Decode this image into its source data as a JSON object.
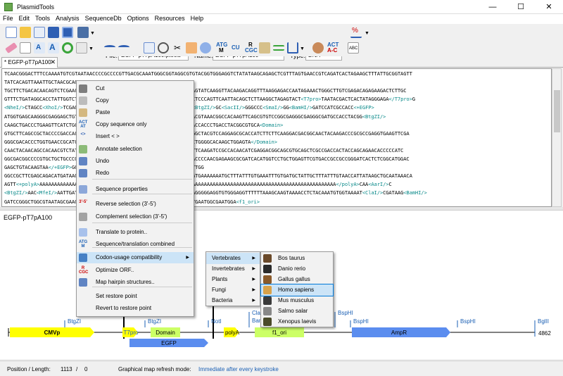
{
  "window": {
    "title": "PlasmidTools",
    "minimize": "—",
    "maximize": "☐",
    "close": "✕"
  },
  "menubar": [
    "File",
    "Edit",
    "Tools",
    "Analysis",
    "SequenceDb",
    "Options",
    "Resources",
    "Help"
  ],
  "toolbar": {
    "file_label": "File:",
    "file_value": "EGFP-pT7pA100.ptools",
    "name_label": "Name:",
    "name_value": "EGFP-pT7pA100",
    "type_label": "Type:",
    "type_value": "DNA",
    "atg_text": "ATG",
    "m_text": "M",
    "cu_text": "CU",
    "r_text": "R",
    "cgc_text": "CGC",
    "c_text": "C",
    "act_text": "ACT",
    "ac_text": "A-C",
    "abc_text": "ABC"
  },
  "tab": {
    "label": "* EGFP-pT7pA100",
    "close": "✕"
  },
  "sequence_lines": [
    [
      "TCAACGGGACTTTCCAAAATGTCGTAATAACCCCGCCCCGTTGACGCAAATGGGCGGTAGGCGTGTACGGTGGGAGGTCTATATAAGCAGAGCTCGTTTAGTGAACCGTCAGATCACTAGAAGCTTTATTGCGGTAGTT"
    ],
    [
      "TATCACAGTTAAATTGCTAACGCAGTCAGTG",
      "tag:<CMVp/>"
    ],
    [
      "TGCTTCTGACACAACAGTCTCGAACTTAAGCTGCAGAAGTTGGTCGTGAGGCACTGGGCAGGTAAGTATCAAGGTTACAAGACAGGTTTAAGGAGACCAATAGAAACTGGGCTTGTCGAGACAGAGAAGACTCTTGC"
    ],
    [
      "GTTTCTGATAGGCACCTATTGGTCTTACTGACATCCACTTTGCCTTTCTCTCCACAGGTGTCCACTCCCAGTTCAATTACAGCTCTTAAGGCTAGAGTACT",
      "tag:<T7pro>",
      "TAATACGACTCACTATAGGGAGA",
      "tag:</T7pro>",
      "G"
    ],
    [
      "tag:<NheI/>",
      "CTAGCC",
      "tag:<XhoI/>",
      "TCGAGCTCAAGCTTCGAATTCTG",
      "tag:<Acc65I/>",
      "GTAC",
      "tag:<KpnI/>",
      "C",
      "tag:<BtgZI/>",
      "GC",
      "tag:<SacII/>",
      "GGGCCC",
      "tag:<SmaI/>",
      "GG",
      "tag:<BamHI/>",
      "GATCCATCGCCACC",
      "tag:<+EGFP>"
    ],
    [
      "ATGGTGAGCAAGGGCGAGGAGCTGTTCACCGGGGTGGTGCCCATCCTGGTCGAGCTGGACGGCGACGTAAACGGCCACAAGTTCAGCGTGTCCGGCGAGGGCGAGGGCGATGCCACCTACGG",
      "tag:<BtgZI/>"
    ],
    [
      "CAAGCTGACCCTGAAGTTCATCTGCACCACCGGCAAGCTGCCCGTGCCCTGGCCCACCCTCGTGACCACCCTGACCTACGGCGTGCA",
      "tag:<Domain>"
    ],
    [
      "GTGCTTCAGCCGCTACCCCGACCACATGAAGCAGCACGACTTCTTCAAGTCCGCCATGCCCGAAGGCTACGTCCAGGAGCGCACCATCTTCTTCAAGGACGACGGCAACTACAAGACCCGCGCCGAGGTGAAGTTCGA"
    ],
    [
      "GGGCGACACCCTGGTGAACCGCATCGAGCTGAAGGGCATCGACTTCAAGGAGGACGGCAACATCCTGGGGCACAAGCTGGAGTA",
      "tag:</Domain>"
    ],
    [
      "CAACTACAACAGCCACAACGTCTATATCATGGCCGACAAGCAGAAGAACGGCATCAAGGTGAACTTCAAGATCCGCCACAACATCGAGGACGGCAGCGTGCAGCTCGCCGACCACTACCAGCAGAACACCCCCATC"
    ],
    [
      "GGCGACGGCCCCGTGCTGCTGCCCGACAACCACTACCTGAGCACCCAGTCCGCCCTGAGCAAAGACCCCAACGAGAAGCGCGATCACATGGTCCTGCTGGAGTTCGTGACCGCCGCCGGGATCACTCTCGGCATGGAC"
    ],
    [
      "GAGCTGTACAAGTAA",
      "tag:</+EGFP>",
      "GCGGCCGCTTCGAGCAGACATGATAAGATACATTGATGAGTTTGG"
    ],
    [
      "GGCCGCTTCGAGCAGACATGATAAGATACATTGATGAGTTTGGACAAACCACAACTAGAATGCAGTGAAAAAAATGCTTTATTTGTGAAATTTGTGATGCTATTGCTTTATTTGTAACCATTATAAGCTGCAATAAACA"
    ],
    [
      "AGTT",
      "tag:<+polyA>",
      "AAAAAAAAAAAAAAAAAAAAAAAAAAAAAAAAAAAAAAAAAAAAAAAAAAAAAAAAAAAAAAAAAAAAAAAAAAAAAAAAAAAAAAAAAAAAAAAAAAAAA",
      "tag:</polyA>",
      "CAA",
      "tag:<AarI/>",
      "C"
    ],
    [
      "tag:<BtgZI/>",
      "AAC",
      "tag:<MfeI/>",
      "AATTGATCCTCGAGAAGTGGTTTTTTGCCCACCTTGTTTCAGGTTCAGGGGGAGGTGTGGGAGGTTTTTTAAAGCAAGTAAAACCTCTACAAATGTGGTAAAAT",
      "tag:<ClaI/>",
      "CGATAAG",
      "tag:<BamHI/>"
    ],
    [
      "GATCCGGGCTGGCGTAATAGCGAAGAGGCCCGCACCGATCGCCCTTCCCAACAGTTGCGCAGCCTGAATGGCGAATGGA",
      "tag:<f1_ori>"
    ]
  ],
  "map": {
    "title": "EGFP-pT7pA100",
    "features": [
      "CMVp",
      "T7pro",
      "Domain",
      "EGFP",
      "polyA",
      "f1_ori",
      "AmpR"
    ],
    "sites": [
      "BtgZI",
      "BtgZI",
      "NotI",
      "Nhel",
      "ClaI",
      "Bam",
      "BspHI",
      "BspHI",
      "BspHI",
      "BglII"
    ],
    "length_label": "4862"
  },
  "status": {
    "position_label": "Position / Length:",
    "position_value": "1113",
    "slash": "/",
    "length_value": "0",
    "refresh_label": "Graphical map refresh mode:",
    "refresh_value": "Immediate after every keystroke"
  },
  "context_menu": {
    "items": [
      {
        "label": "Cut",
        "icon": "scissors-icon"
      },
      {
        "label": "Copy",
        "icon": "copy-icon"
      },
      {
        "label": "Paste",
        "icon": "paste-icon"
      },
      {
        "label": "Copy sequence only",
        "icon": "copy-sequence-icon",
        "icon_text": "ACT AT"
      },
      {
        "label": "Insert < >",
        "icon": "insert-tag-icon",
        "icon_text": "<>"
      },
      {
        "label": "Annotate selection",
        "icon": "annotate-icon"
      },
      {
        "label": "Undo",
        "icon": "undo-icon"
      },
      {
        "label": "Redo",
        "icon": "redo-icon"
      },
      {
        "label": "Sequence properties",
        "icon": "properties-icon"
      },
      {
        "label": "Reverse selection (3'-5')",
        "icon": "reverse-icon",
        "icon_text": "3'-5'"
      },
      {
        "label": "Complement selection (3'-5')",
        "icon": "complement-icon"
      },
      {
        "label": "Translate to protein..",
        "icon": "translate-icon"
      },
      {
        "label": "Sequence/translation combined",
        "icon": "combined-icon",
        "icon_text": "ATG M"
      },
      {
        "label": "Codon-usage compatibility",
        "icon": "codon-icon"
      },
      {
        "label": "Optimize ORF..",
        "icon": "optimize-icon",
        "icon_text": "R CGC"
      },
      {
        "label": "Map hairpin structures..",
        "icon": "hairpin-icon"
      },
      {
        "label": "Set restore point",
        "icon": ""
      },
      {
        "label": "Revert to restore point",
        "icon": ""
      }
    ],
    "groups": [
      "Vertebrates",
      "Invertebrates",
      "Plants",
      "Fungi",
      "Bacteria"
    ],
    "species": [
      "Bos taurus",
      "Danio rerio",
      "Gallus gallus",
      "Homo sapiens",
      "Mus musculus",
      "Salmo salar",
      "Xenopus laevis"
    ]
  },
  "colors": {
    "accent": "#0078d7",
    "menu_highlight": "#cce4f7",
    "tag": "#0a8a8a",
    "feature_yellow": "#ffff00",
    "feature_green": "#ccff66",
    "feature_blue": "#5b8def"
  }
}
